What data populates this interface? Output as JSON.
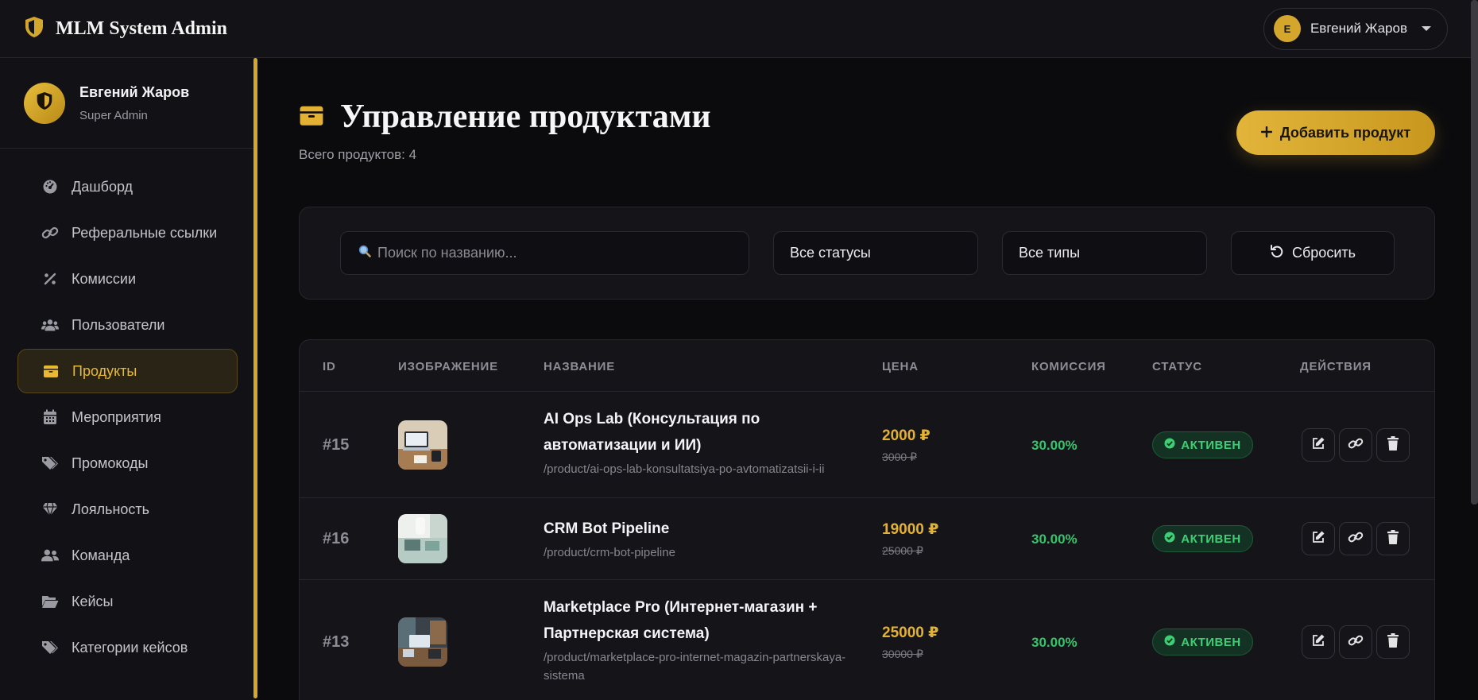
{
  "topbar": {
    "brand": "MLM System Admin",
    "user_initial": "E",
    "user_name": "Евгений Жаров"
  },
  "profile": {
    "name": "Евгений Жаров",
    "role": "Super Admin"
  },
  "sidebar": {
    "items": [
      {
        "label": "Дашборд",
        "icon": "dashboard-icon"
      },
      {
        "label": "Реферальные ссылки",
        "icon": "link-icon"
      },
      {
        "label": "Комиссии",
        "icon": "percent-icon"
      },
      {
        "label": "Пользователи",
        "icon": "users-icon"
      },
      {
        "label": "Продукты",
        "icon": "box-icon",
        "active": true
      },
      {
        "label": "Мероприятия",
        "icon": "calendar-icon"
      },
      {
        "label": "Промокоды",
        "icon": "tags-icon"
      },
      {
        "label": "Лояльность",
        "icon": "gem-icon"
      },
      {
        "label": "Команда",
        "icon": "team-icon"
      },
      {
        "label": "Кейсы",
        "icon": "folder-icon"
      },
      {
        "label": "Категории кейсов",
        "icon": "tag-icon"
      }
    ]
  },
  "page": {
    "title": "Управление продуктами",
    "subtitle": "Всего продуктов: 4",
    "add_button": "Добавить продукт"
  },
  "filters": {
    "search_placeholder": "Поиск по названию...",
    "status_select": "Все статусы",
    "type_select": "Все типы",
    "reset_button": "Сбросить"
  },
  "table": {
    "columns": [
      "ID",
      "ИЗОБРАЖЕНИЕ",
      "НАЗВАНИЕ",
      "ЦЕНА",
      "КОМИССИЯ",
      "СТАТУС",
      "ДЕЙСТВИЯ"
    ],
    "rows": [
      {
        "id": "#15",
        "name": "AI Ops Lab (Консультация по автоматизации и ИИ)",
        "slug": "/product/ai-ops-lab-konsultatsiya-po-avtomatizatsii-i-ii",
        "price": "2000 ₽",
        "old_price": "3000 ₽",
        "commission": "30.00%",
        "status": "АКТИВЕН"
      },
      {
        "id": "#16",
        "name": "CRM Bot Pipeline",
        "slug": "/product/crm-bot-pipeline",
        "price": "19000 ₽",
        "old_price": "25000 ₽",
        "commission": "30.00%",
        "status": "АКТИВЕН"
      },
      {
        "id": "#13",
        "name": "Marketplace Pro (Интернет-магазин + Партнерская система)",
        "slug": "/product/marketplace-pro-internet-magazin-partnerskaya-sistema",
        "price": "25000 ₽",
        "old_price": "30000 ₽",
        "commission": "30.00%",
        "status": "АКТИВЕН"
      }
    ]
  },
  "colors": {
    "accent": "#d4a72c",
    "success": "#37c46c",
    "background": "#0b0b0e"
  }
}
